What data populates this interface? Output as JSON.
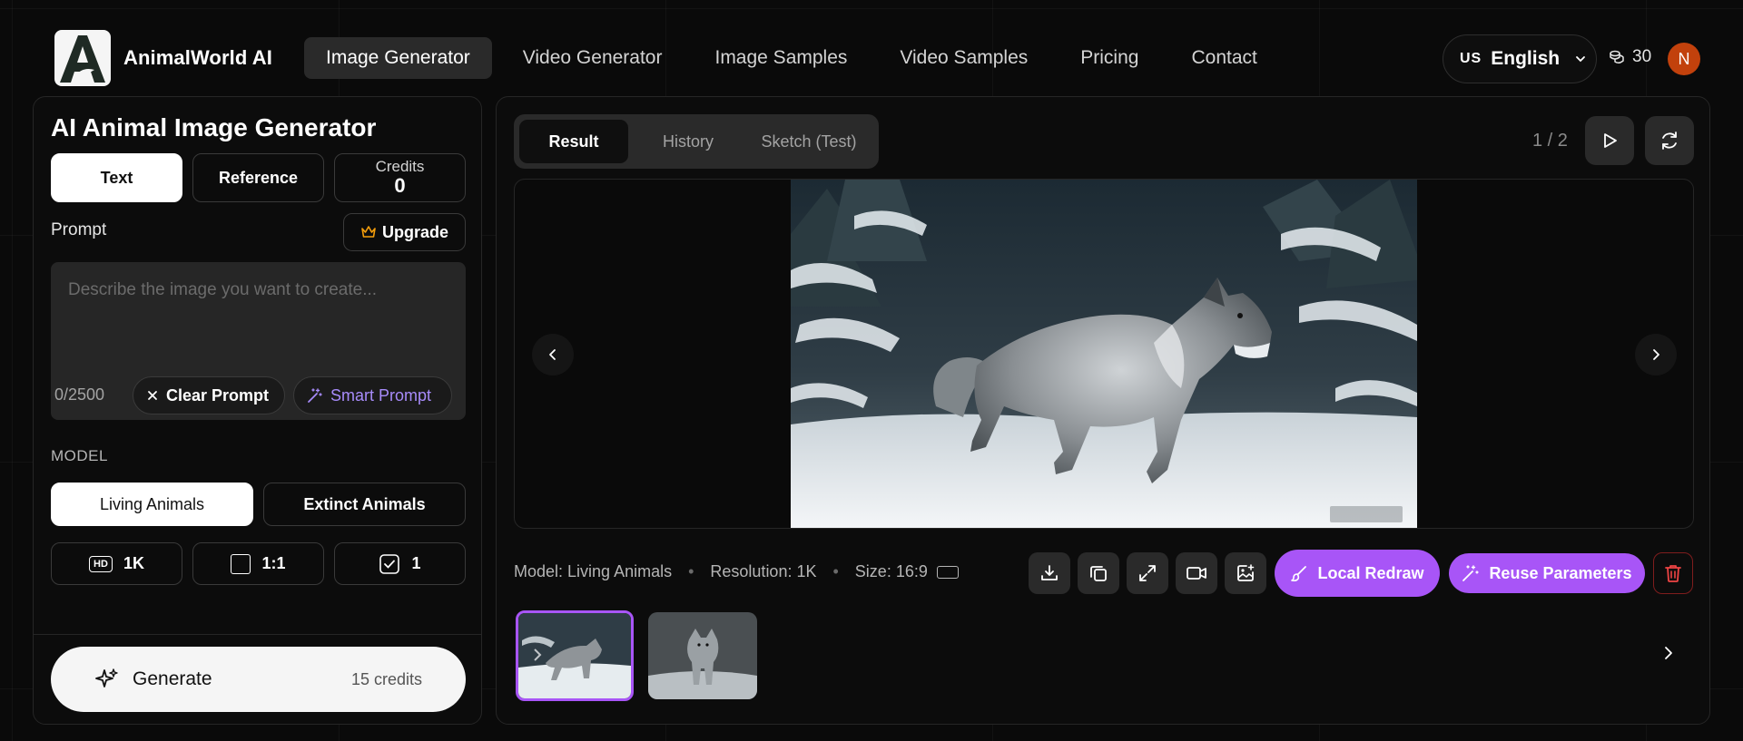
{
  "header": {
    "brand": "AnimalWorld AI",
    "nav": [
      {
        "label": "Image Generator",
        "active": true
      },
      {
        "label": "Video Generator"
      },
      {
        "label": "Image Samples"
      },
      {
        "label": "Video Samples"
      },
      {
        "label": "Pricing"
      },
      {
        "label": "Contact"
      }
    ],
    "language_code": "US",
    "language": "English",
    "coins": "30",
    "avatar_initial": "N"
  },
  "left": {
    "title": "AI Animal Image Generator",
    "tabs": {
      "text": "Text",
      "reference": "Reference"
    },
    "credits_label": "Credits",
    "credits_value": "0",
    "prompt_label": "Prompt",
    "upgrade_label": "Upgrade",
    "prompt_placeholder": "Describe the image you want to create...",
    "counter": "0/2500",
    "clear_label": "Clear Prompt",
    "smart_label": "Smart Prompt",
    "model_label": "MODEL",
    "models": {
      "living": "Living Animals",
      "extinct": "Extinct Animals"
    },
    "options": {
      "hd_badge": "HD",
      "resolution": "1K",
      "ratio": "1:1",
      "count": "1"
    },
    "generate_label": "Generate",
    "generate_cost": "15 credits"
  },
  "right": {
    "tabs": {
      "result": "Result",
      "history": "History",
      "sketch": "Sketch (Test)"
    },
    "pager": "1 / 2",
    "meta": {
      "model": "Model: Living Animals",
      "resolution": "Resolution: 1K",
      "size": "Size: 16:9"
    },
    "local_redraw": "Local Redraw",
    "reuse_parameters": "Reuse Parameters"
  },
  "colors": {
    "accent": "#a855f7",
    "avatar": "#c2410c",
    "upgrade_icon": "#f59e0b"
  }
}
